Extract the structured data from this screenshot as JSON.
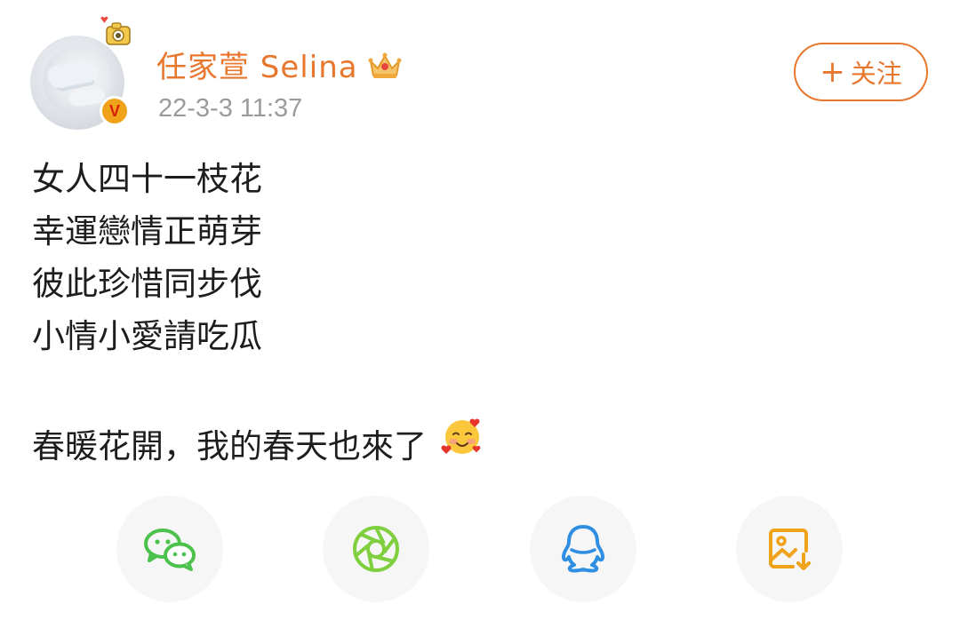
{
  "header": {
    "username": "任家萱 Selina",
    "timestamp": "22-3-3 11:37",
    "follow_label": "关注",
    "follow_prefix": "+"
  },
  "post": {
    "lines": [
      "女人四十一枝花",
      "幸運戀情正萌芽",
      "彼此珍惜同步伐",
      "小情小愛請吃瓜"
    ],
    "last_line": "春暖花開，我的春天也來了",
    "emoji": "smiling-face-with-hearts"
  },
  "share": {
    "items": [
      "wechat-icon",
      "moments-icon",
      "qq-icon",
      "save-image-icon"
    ]
  },
  "colors": {
    "accent": "#e8772e",
    "text": "#1d1d1d",
    "muted": "#9b9b9b",
    "wechat": "#4cc24c",
    "moments": "#7fcf3e",
    "qq": "#2f8fe3",
    "save": "#f0a21b"
  }
}
